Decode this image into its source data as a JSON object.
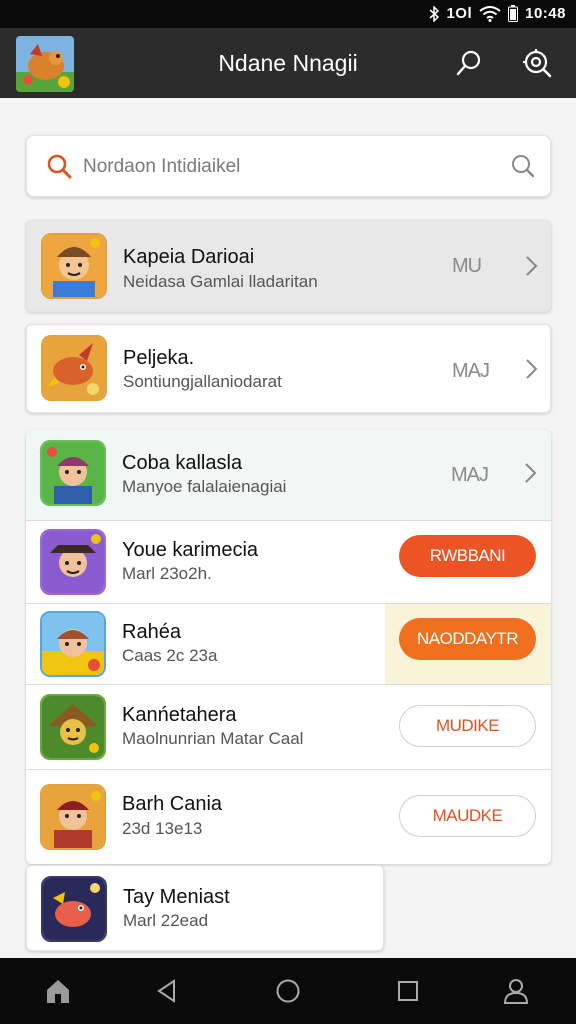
{
  "status_bar": {
    "time": "10:48",
    "network_label": "1Ol",
    "icons": [
      "bluetooth-icon",
      "signal-icon",
      "wifi-icon",
      "battery-icon"
    ]
  },
  "app_bar": {
    "title": "Ndane Nnagii",
    "actions": [
      "search-icon",
      "target-icon"
    ]
  },
  "search": {
    "placeholder": "Nordaon Intidiaikel"
  },
  "games": [
    {
      "title": "Kapeia Darioai",
      "subtitle": "Neidasa Gamlai lladaritan",
      "tag": "MU",
      "action": "chevron"
    },
    {
      "title": "Peljeka.",
      "subtitle": "Sontiungjallaniodarat",
      "tag": "MAJ",
      "action": "chevron"
    },
    {
      "title": "Coba kallasla",
      "subtitle": "Manyoe falalaienagiai",
      "tag": "MAJ",
      "action": "chevron"
    },
    {
      "title": "Youe karimecia",
      "subtitle": "Marl 23o2h.",
      "button": "RWBBANI",
      "style": "filled"
    },
    {
      "title": "Rahéa",
      "subtitle": "Caas 2c 23a",
      "button": "NAODDAYTR",
      "style": "filled-highlight"
    },
    {
      "title": "Kanńetahera",
      "subtitle": "Maolnunrian Matar Caal",
      "button": "MUDIKE",
      "style": "outline"
    },
    {
      "title": "Barh Cania",
      "subtitle": "23d 13e13",
      "button": "MAUDKE",
      "style": "outline"
    },
    {
      "title": "Tay Meniast",
      "subtitle": "Marl 22ead",
      "button": "",
      "style": "none"
    }
  ],
  "colors": {
    "accent": "#ec5425",
    "accent_secondary": "#f07020",
    "app_bar": "#2c2c2c",
    "background": "#f4f4f4"
  },
  "nav": [
    "home-icon",
    "back-icon",
    "circle-home-icon",
    "recents-icon",
    "profile-icon"
  ]
}
